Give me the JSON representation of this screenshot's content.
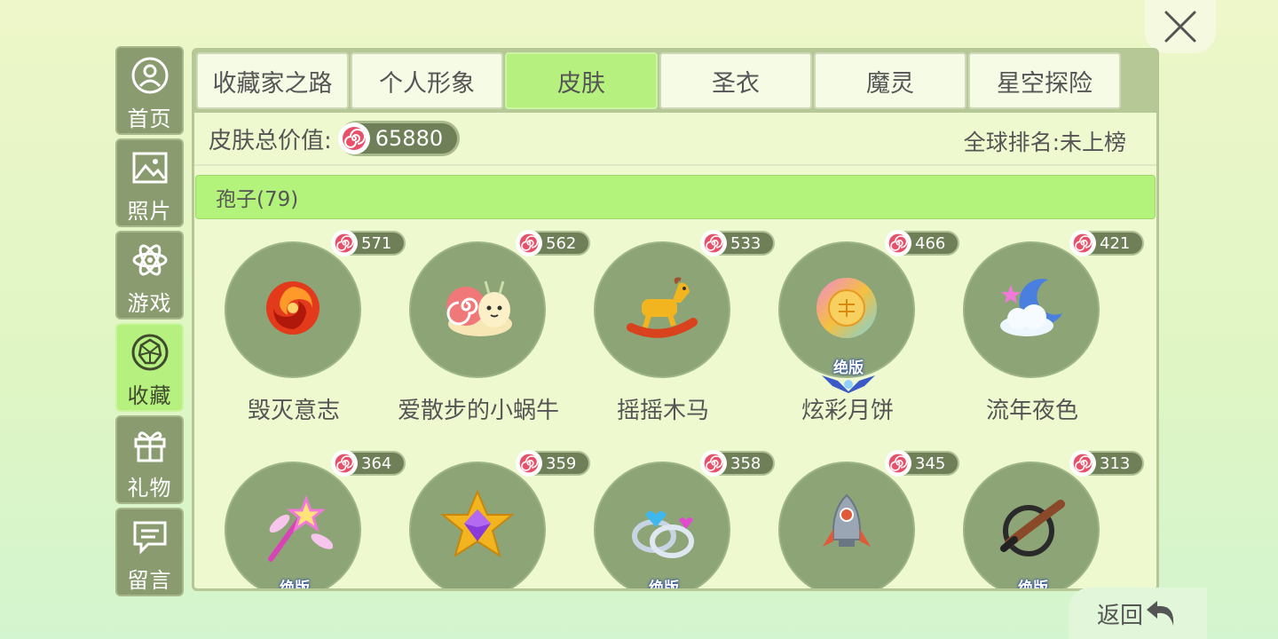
{
  "sidebar": {
    "items": [
      {
        "label": "首页",
        "icon": "home-icon",
        "active": false
      },
      {
        "label": "照片",
        "icon": "photo-icon",
        "active": false
      },
      {
        "label": "游戏",
        "icon": "game-icon",
        "active": false
      },
      {
        "label": "收藏",
        "icon": "collection-icon",
        "active": true
      },
      {
        "label": "礼物",
        "icon": "gift-icon",
        "active": false
      },
      {
        "label": "留言",
        "icon": "message-icon",
        "active": false
      }
    ]
  },
  "tabs": [
    {
      "label": "收藏家之路",
      "active": false
    },
    {
      "label": "个人形象",
      "active": false
    },
    {
      "label": "皮肤",
      "active": true
    },
    {
      "label": "圣衣",
      "active": false
    },
    {
      "label": "魔灵",
      "active": false
    },
    {
      "label": "星空探险",
      "active": false
    }
  ],
  "summary": {
    "total_label": "皮肤总价值:",
    "total_value": "65880",
    "rank_text": "全球排名:未上榜"
  },
  "category": {
    "label": "孢子(79)"
  },
  "items": [
    {
      "name": "毁灭意志",
      "price": "571",
      "icon": "vortex-icon",
      "limited": false
    },
    {
      "name": "爱散步的小蜗牛",
      "price": "562",
      "icon": "snail-icon",
      "limited": false
    },
    {
      "name": "摇摇木马",
      "price": "533",
      "icon": "rocking-horse-icon",
      "limited": false
    },
    {
      "name": "炫彩月饼",
      "price": "466",
      "icon": "mooncake-icon",
      "limited": true
    },
    {
      "name": "流年夜色",
      "price": "421",
      "icon": "moon-cloud-icon",
      "limited": false
    },
    {
      "name": "",
      "price": "364",
      "icon": "magic-wand-icon",
      "limited": true
    },
    {
      "name": "",
      "price": "359",
      "icon": "star-gem-icon",
      "limited": false
    },
    {
      "name": "",
      "price": "358",
      "icon": "rings-icon",
      "limited": true
    },
    {
      "name": "",
      "price": "345",
      "icon": "rocket-icon",
      "limited": false
    },
    {
      "name": "",
      "price": "313",
      "icon": "brush-icon",
      "limited": true
    }
  ],
  "badge_text": "绝版",
  "back": {
    "label": "返回"
  },
  "colors": {
    "accent": "#b6f07e",
    "sidebar": "#8a9c6f",
    "circle": "#8da476",
    "coin": "#e8506a"
  }
}
